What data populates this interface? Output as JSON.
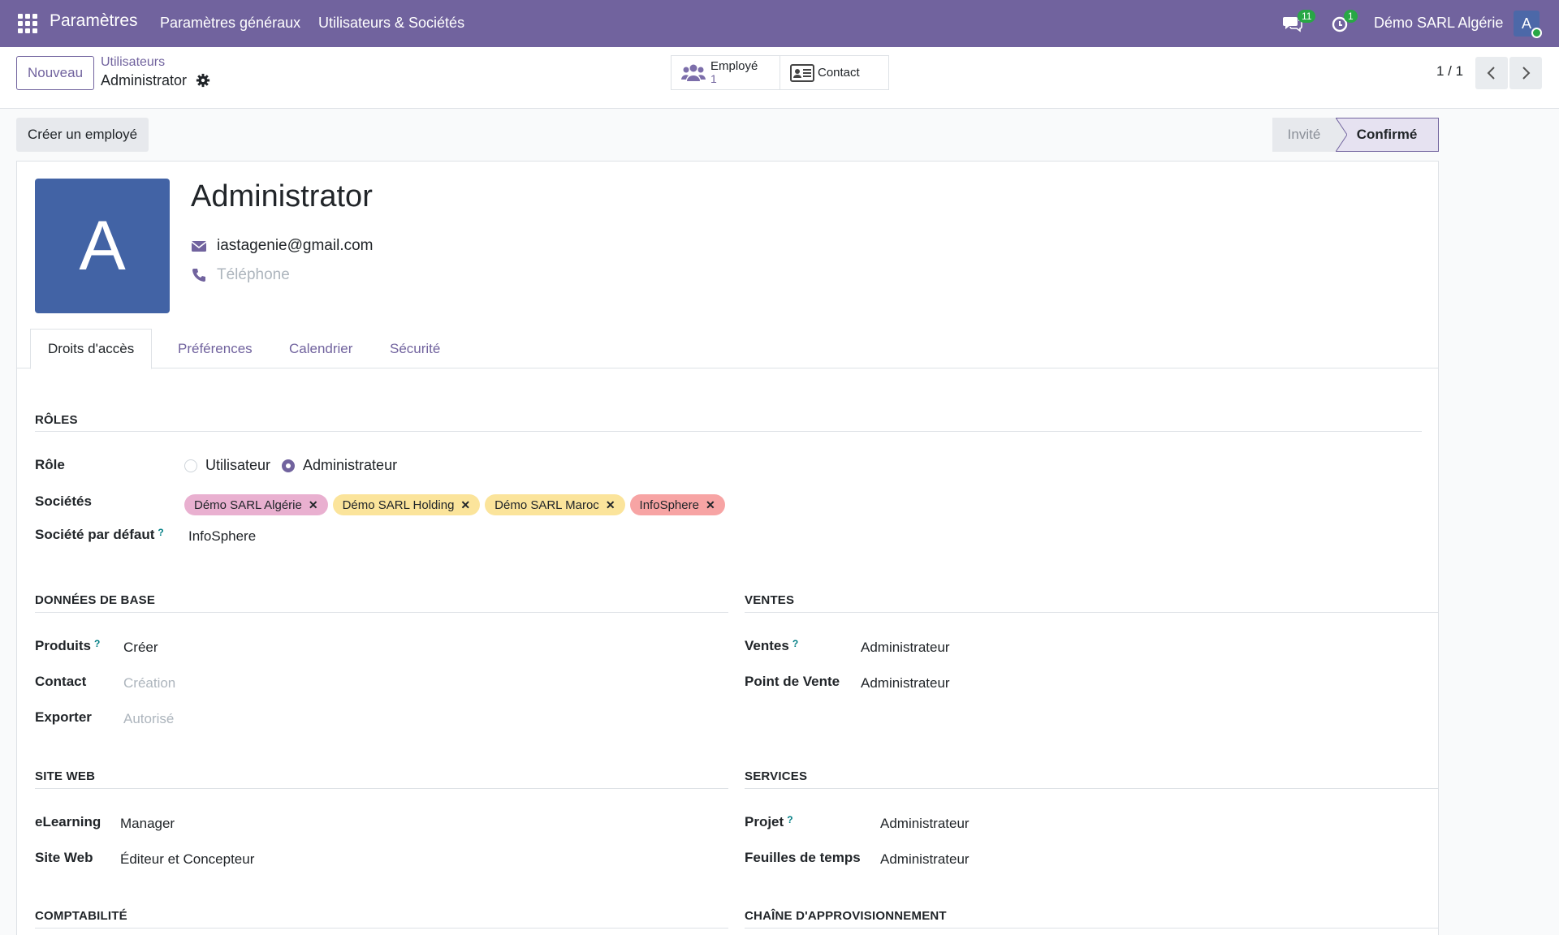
{
  "navbar": {
    "brand": "Paramètres",
    "menu": [
      "Paramètres généraux",
      "Utilisateurs & Sociétés"
    ],
    "messages_count": "11",
    "activities_count": "1",
    "company": "Démo SARL Algérie",
    "user_initial": "A",
    "accent_color": "#71639e"
  },
  "control_panel": {
    "new_button": "Nouveau",
    "breadcrumb_parent": "Utilisateurs",
    "breadcrumb_current": "Administrator",
    "smart_buttons": [
      {
        "label": "Employé",
        "value": "1",
        "icon": "users-icon"
      },
      {
        "label": "Contact",
        "icon": "id-card-icon"
      }
    ],
    "pager": "1 / 1"
  },
  "status": {
    "create_employee_button": "Créer un employé",
    "stages": [
      "Invité",
      "Confirmé"
    ],
    "current_stage": "Confirmé"
  },
  "form": {
    "avatar_initial": "A",
    "avatar_color": "#4263a5",
    "name": "Administrator",
    "email": "iastagenie@gmail.com",
    "phone_placeholder": "Téléphone",
    "tabs": [
      "Droits d'accès",
      "Préférences",
      "Calendrier",
      "Sécurité"
    ],
    "active_tab": "Droits d'accès"
  },
  "roles": {
    "title": "RÔLES",
    "role_label": "Rôle",
    "role_options": [
      "Utilisateur",
      "Administrateur"
    ],
    "role_selected": "Administrateur",
    "companies_label": "Sociétés",
    "companies": [
      {
        "name": "Démo SARL Algérie",
        "color": "#e9b0d0"
      },
      {
        "name": "Démo SARL Holding",
        "color": "#fbe49b"
      },
      {
        "name": "Démo SARL Maroc",
        "color": "#fbe49b"
      },
      {
        "name": "InfoSphere",
        "color": "#f7a4a4"
      }
    ],
    "default_company_label": "Société par défaut",
    "default_company": "InfoSphere"
  },
  "base_data": {
    "title": "DONNÉES DE BASE",
    "products_label": "Produits",
    "products_value": "Créer",
    "contact_label": "Contact",
    "contact_placeholder": "Création",
    "export_label": "Exporter",
    "export_placeholder": "Autorisé"
  },
  "sales": {
    "title": "VENTES",
    "sales_label": "Ventes",
    "sales_value": "Administrateur",
    "pos_label": "Point de Vente",
    "pos_value": "Administrateur"
  },
  "website": {
    "title": "SITE WEB",
    "elearning_label": "eLearning",
    "elearning_value": "Manager",
    "site_label": "Site Web",
    "site_value": "Éditeur et Concepteur"
  },
  "services": {
    "title": "SERVICES",
    "project_label": "Projet",
    "project_value": "Administrateur",
    "timesheets_label": "Feuilles de temps",
    "timesheets_value": "Administrateur"
  },
  "accounting": {
    "title": "COMPTABILITÉ"
  },
  "supply_chain": {
    "title": "CHAÎNE D'APPROVISIONNEMENT"
  }
}
